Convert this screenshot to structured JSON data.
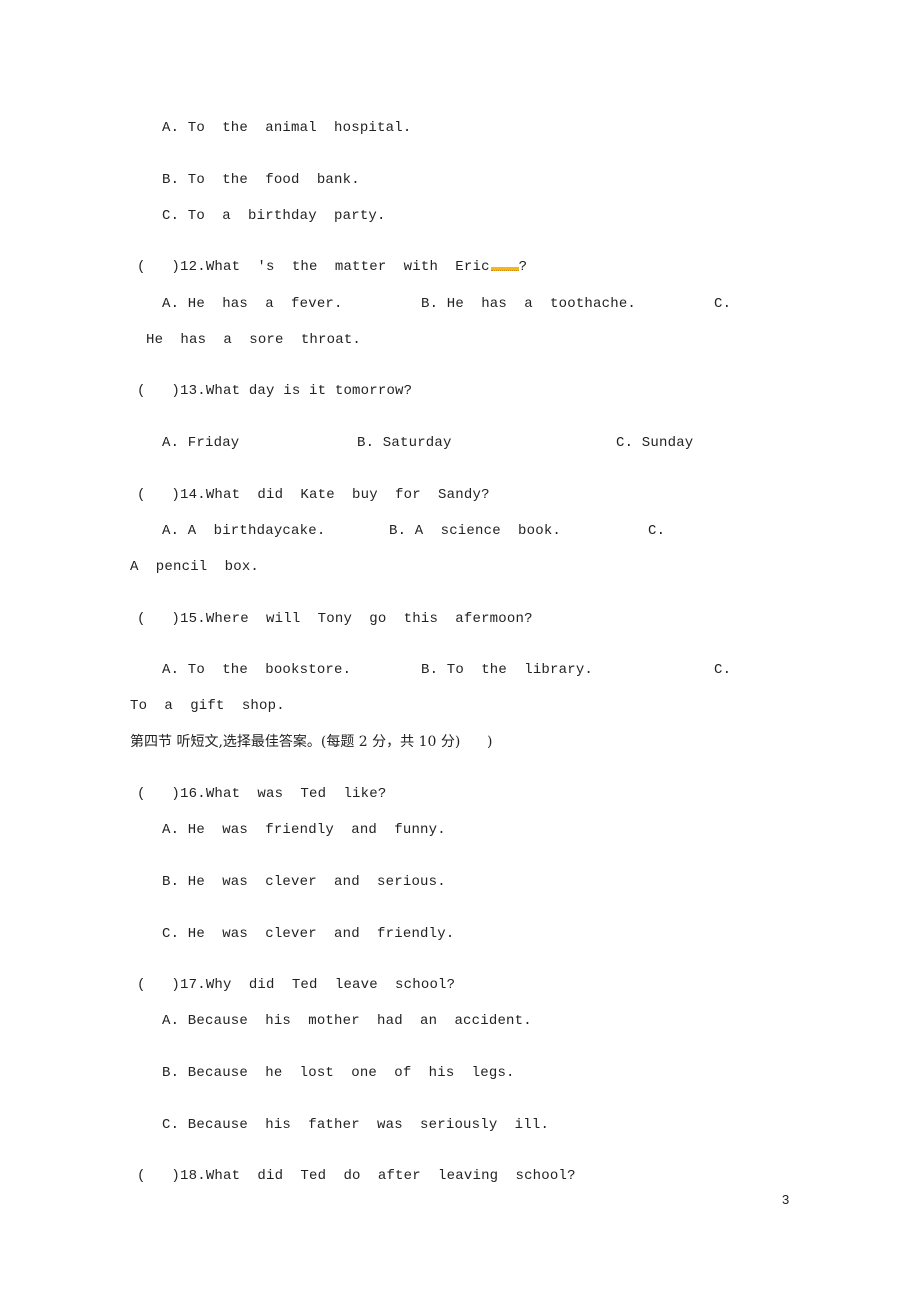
{
  "q11_options": {
    "a": "A. To  the  animal  hospital.",
    "b": "B. To  the  food  bank.",
    "c": "C. To  a  birthday  party."
  },
  "q12": {
    "paren": "(   )",
    "stem_before": "12.What  's  the  matter  with  Eric",
    "stem_after": "?",
    "a": "A. He  has  a  fever.",
    "b": "B. He  has  a  toothache.",
    "c_label": "C.",
    "c_text": "He  has  a  sore  throat."
  },
  "q13": {
    "paren": "(   )",
    "stem": "13.What day is it tomorrow?",
    "a": "A. Friday",
    "b": "B. Saturday",
    "c": "C. Sunday"
  },
  "q14": {
    "paren": "(   )",
    "stem": "14.What  did  Kate  buy  for  Sandy?",
    "a": "A. A  birthdaycake.",
    "b": "B. A  science  book.",
    "c_label": "C.",
    "c_text": "A  pencil  box."
  },
  "q15": {
    "paren": "(   )",
    "stem": "15.Where  will  Tony  go  this  afermoon?",
    "a": "A. To  the  bookstore.",
    "b": "B. To  the  library.",
    "c_label": "C.",
    "c_text": "To  a  gift  shop."
  },
  "section4": {
    "heading": "第四节 听短文,选择最佳答案。(每题 2 分，共 10 分)      )"
  },
  "q16": {
    "paren": "(   )",
    "stem": "16.What  was  Ted  like?",
    "a": "A. He  was  friendly  and  funny.",
    "b": "B. He  was  clever  and  serious.",
    "c": "C. He  was  clever  and  friendly."
  },
  "q17": {
    "paren": "(   )",
    "stem": "17.Why  did  Ted  leave  school?",
    "a": "A. Because  his  mother  had  an  accident.",
    "b": "B. Because  he  lost  one  of  his  legs.",
    "c": "C. Because  his  father  was  seriously  ill."
  },
  "q18": {
    "paren": "(   )",
    "stem": "18.What  did  Ted  do  after  leaving  school?"
  },
  "page_number": "3"
}
